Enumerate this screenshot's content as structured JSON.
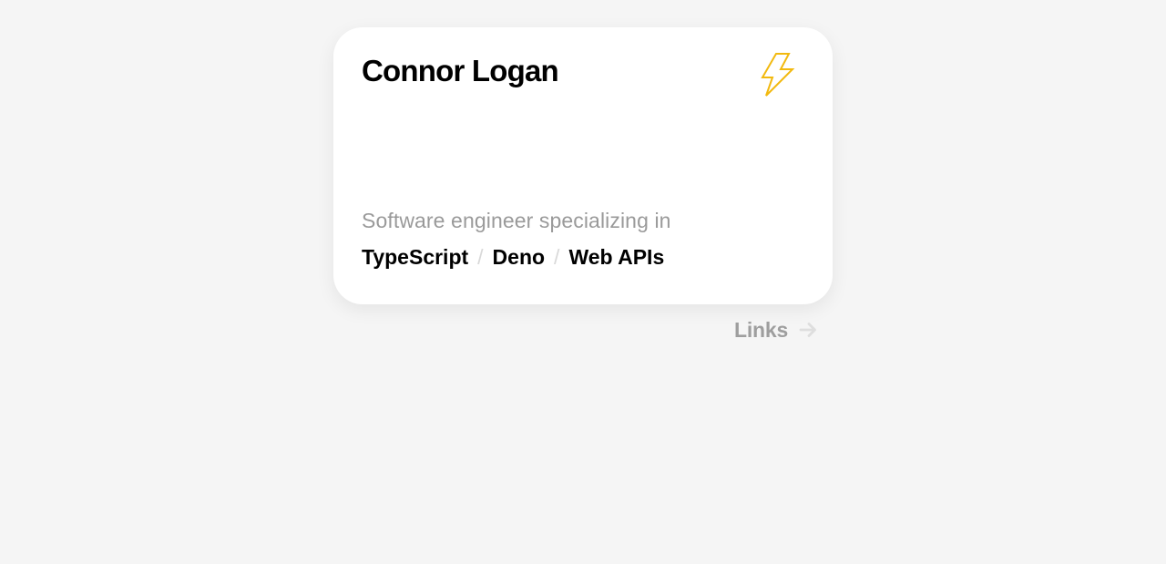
{
  "card": {
    "name": "Connor Logan",
    "icon": "lightning-bolt-icon",
    "tagline": "Software engineer specializing in",
    "skills": [
      "TypeScript",
      "Deno",
      "Web APIs"
    ],
    "separator": "/"
  },
  "links": {
    "label": "Links",
    "icon": "arrow-right-icon"
  },
  "colors": {
    "background": "#f5f5f5",
    "card": "#ffffff",
    "bolt": "#f2b90f",
    "muted_text": "#9a9a9a"
  }
}
